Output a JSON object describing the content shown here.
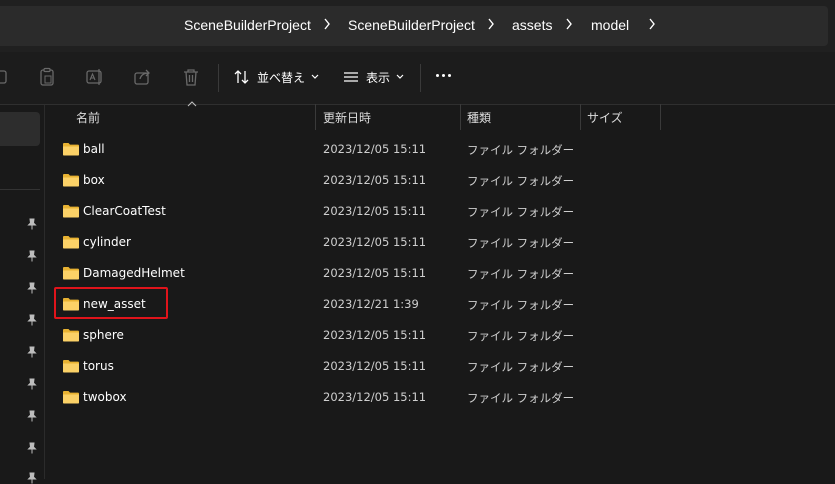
{
  "breadcrumb": {
    "items": [
      "SceneBuilderProject",
      "SceneBuilderProject",
      "assets",
      "model"
    ]
  },
  "toolbar": {
    "sort_label": "並べ替え",
    "view_label": "表示"
  },
  "columns": {
    "name": "名前",
    "date": "更新日時",
    "type": "種類",
    "size": "サイズ"
  },
  "files": [
    {
      "name": "ball",
      "date": "2023/12/05 15:11",
      "type": "ファイル フォルダー"
    },
    {
      "name": "box",
      "date": "2023/12/05 15:11",
      "type": "ファイル フォルダー"
    },
    {
      "name": "ClearCoatTest",
      "date": "2023/12/05 15:11",
      "type": "ファイル フォルダー"
    },
    {
      "name": "cylinder",
      "date": "2023/12/05 15:11",
      "type": "ファイル フォルダー"
    },
    {
      "name": "DamagedHelmet",
      "date": "2023/12/05 15:11",
      "type": "ファイル フォルダー"
    },
    {
      "name": "new_asset",
      "date": "2023/12/21 1:39",
      "type": "ファイル フォルダー"
    },
    {
      "name": "sphere",
      "date": "2023/12/05 15:11",
      "type": "ファイル フォルダー"
    },
    {
      "name": "torus",
      "date": "2023/12/05 15:11",
      "type": "ファイル フォルダー"
    },
    {
      "name": "twobox",
      "date": "2023/12/05 15:11",
      "type": "ファイル フォルダー"
    }
  ],
  "colors": {
    "background": "#191919",
    "folder": "#f4c542",
    "highlight": "#e0141b"
  },
  "icons": [
    "chevron-right-icon",
    "copy-icon",
    "paste-icon",
    "rename-icon",
    "share-icon",
    "delete-icon",
    "sort-icon",
    "view-icon",
    "more-icon",
    "pin-icon",
    "folder-icon"
  ]
}
